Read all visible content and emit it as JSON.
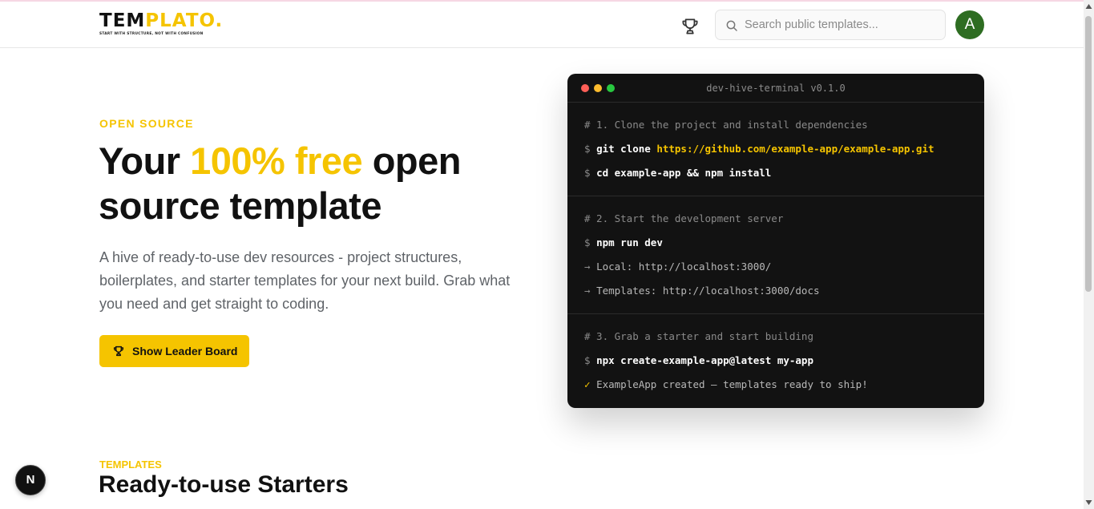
{
  "header": {
    "logo_prefix": "TEM",
    "logo_accent": "PLATO.",
    "logo_tagline": "START WITH STRUCTURE, NOT WITH CONFUSION",
    "search_placeholder": "Search public templates...",
    "avatar_initial": "A",
    "icons": {
      "leaderboard": "trophy-icon",
      "search": "search-icon"
    }
  },
  "hero": {
    "eyebrow": "OPEN SOURCE",
    "title_before": "Your ",
    "title_highlight": "100% free",
    "title_after": " open source template",
    "description": "A hive of ready-to-use dev resources - project structures, boilerplates, and starter templates for your next build. Grab what you need and get straight to coding.",
    "cta_label": "Show Leader Board"
  },
  "terminal": {
    "title": "dev-hive-terminal v0.1.0",
    "prompt": "$",
    "arrow": "→",
    "check": "✓",
    "step1": {
      "comment": "# 1. Clone the project and install dependencies",
      "clone_cmd": "git clone",
      "clone_url": "https://github.com/example-app/example-app.git",
      "install_cmd": "cd example-app && npm install"
    },
    "step2": {
      "comment": "# 2. Start the development server",
      "dev_cmd": "npm run dev",
      "local_output": "Local: http://localhost:3000/",
      "templates_output": "Templates: http://localhost:3000/docs"
    },
    "step3": {
      "comment": "# 3. Grab a starter and start building",
      "create_cmd": "npx create-example-app@latest my-app",
      "success_output": "ExampleApp created — templates ready to ship!"
    }
  },
  "templates_section": {
    "eyebrow": "TEMPLATES",
    "title": "Ready-to-use Starters"
  },
  "dev_badge": {
    "label": "N"
  },
  "colors": {
    "accent": "#f5c400",
    "avatar": "#2e6d22",
    "terminal_bg": "#121212",
    "dot_red": "#ff5f57",
    "dot_yellow": "#febc2e",
    "dot_green": "#28c840"
  }
}
